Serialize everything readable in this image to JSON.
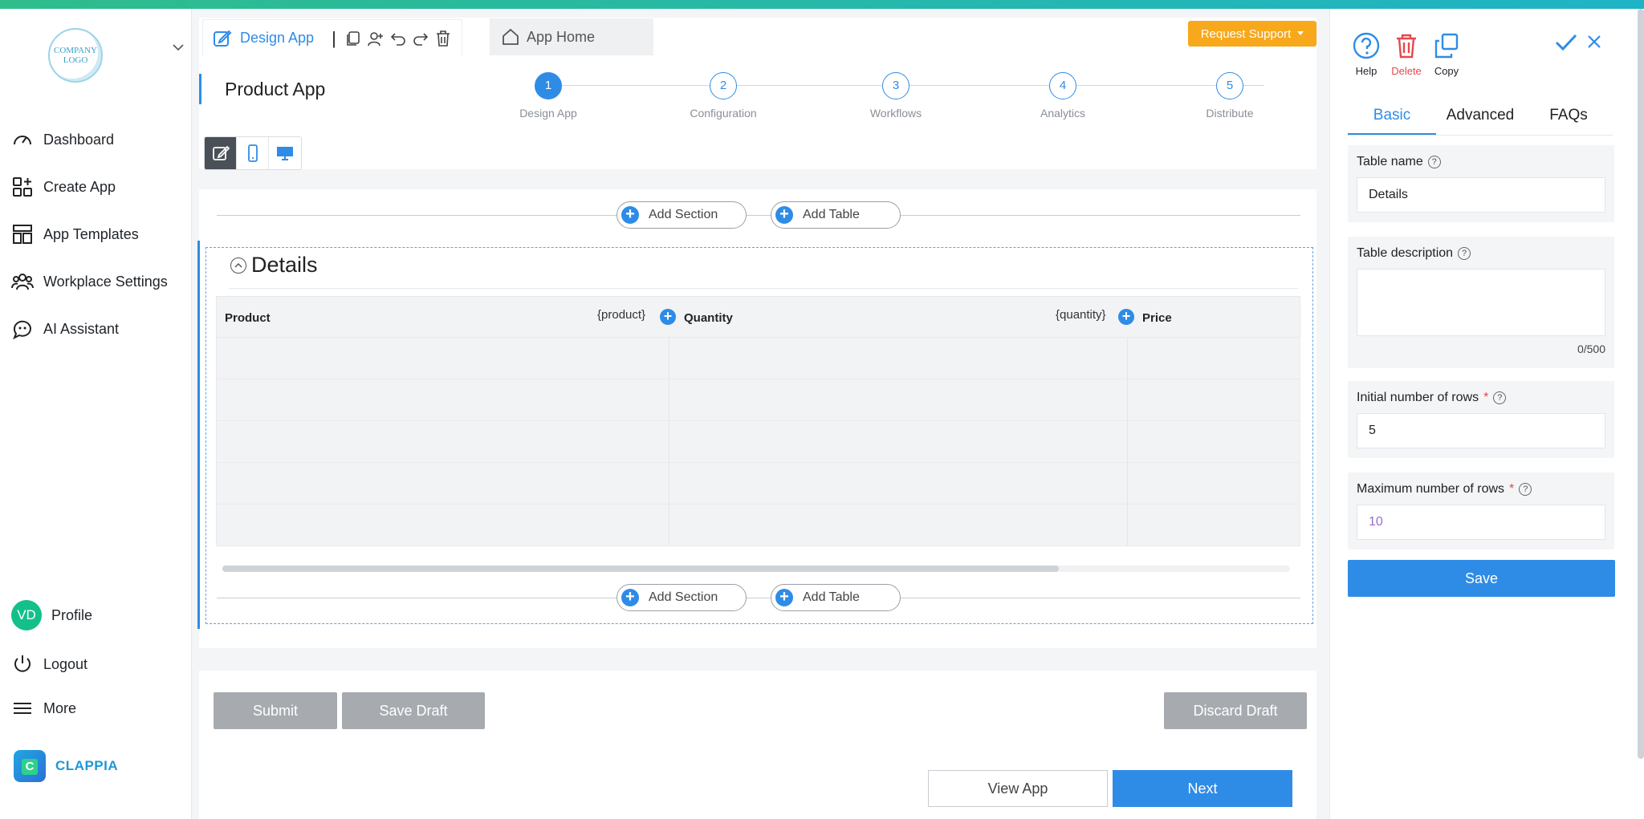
{
  "brand": {
    "logo_text": "COMPANY LOGO",
    "name": "CLAPPIA",
    "accent": "#2e8ce6"
  },
  "sidebar": {
    "items": [
      {
        "label": "Dashboard",
        "icon": "gauge-icon"
      },
      {
        "label": "Create App",
        "icon": "grid-plus-icon"
      },
      {
        "label": "App Templates",
        "icon": "template-icon"
      },
      {
        "label": "Workplace Settings",
        "icon": "users-icon"
      },
      {
        "label": "AI Assistant",
        "icon": "chat-bot-icon"
      }
    ],
    "profile": {
      "initials": "VD",
      "label": "Profile"
    },
    "logout": "Logout",
    "more": "More"
  },
  "header": {
    "design_tab": "Design App",
    "app_home": "App Home",
    "request_support": "Request Support",
    "app_title": "Product App",
    "steps": [
      {
        "num": "1",
        "label": "Design App",
        "active": true
      },
      {
        "num": "2",
        "label": "Configuration",
        "active": false
      },
      {
        "num": "3",
        "label": "Workflows",
        "active": false
      },
      {
        "num": "4",
        "label": "Analytics",
        "active": false
      },
      {
        "num": "5",
        "label": "Distribute",
        "active": false
      }
    ]
  },
  "canvas": {
    "add_section": "Add Section",
    "add_table": "Add Table",
    "section_title": "Details",
    "columns": [
      {
        "label": "Product",
        "placeholder": "{product}"
      },
      {
        "label": "Quantity",
        "placeholder": "{quantity}"
      },
      {
        "label": "Price",
        "placeholder": ""
      }
    ],
    "row_count": 5
  },
  "footer": {
    "submit": "Submit",
    "save_draft": "Save Draft",
    "discard_draft": "Discard Draft",
    "view_app": "View App",
    "next": "Next"
  },
  "right_panel": {
    "tools": {
      "help": "Help",
      "delete": "Delete",
      "copy": "Copy"
    },
    "tabs": [
      "Basic",
      "Advanced",
      "FAQs"
    ],
    "table_name": {
      "label": "Table name",
      "value": "Details"
    },
    "table_description": {
      "label": "Table description",
      "value": "",
      "counter": "0/500"
    },
    "initial_rows": {
      "label": "Initial number of rows",
      "value": "5"
    },
    "max_rows": {
      "label": "Maximum number of rows",
      "value": "10"
    },
    "save": "Save"
  }
}
